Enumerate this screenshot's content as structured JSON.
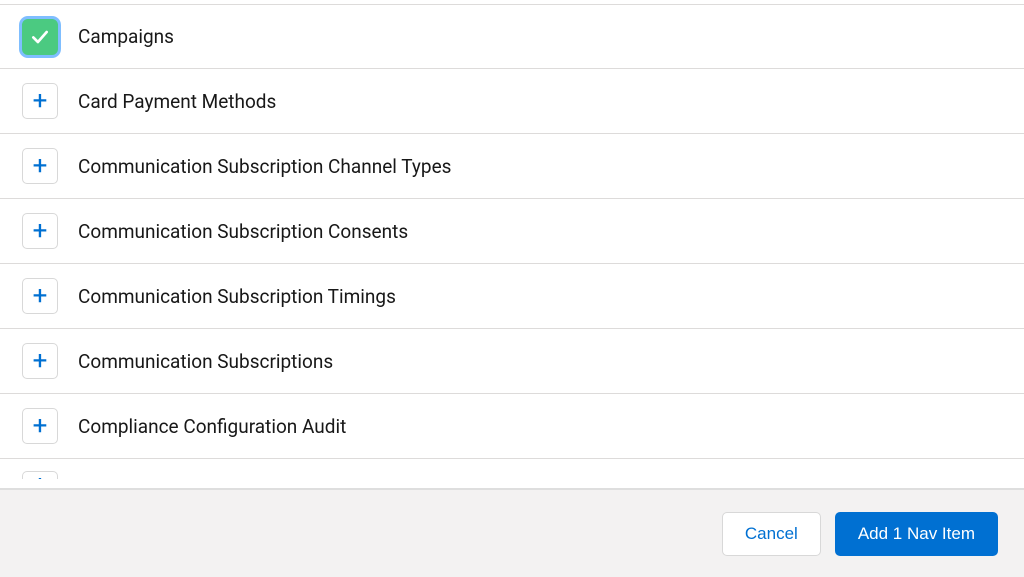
{
  "colors": {
    "brand": "#0070d2",
    "selected": "#4bca81",
    "border": "#dddbda",
    "footer_bg": "#f3f2f2"
  },
  "items": [
    {
      "label": "Campaigns",
      "selected": true,
      "icon": "check"
    },
    {
      "label": "Card Payment Methods",
      "selected": false,
      "icon": "plus"
    },
    {
      "label": "Communication Subscription Channel Types",
      "selected": false,
      "icon": "plus"
    },
    {
      "label": "Communication Subscription Consents",
      "selected": false,
      "icon": "plus"
    },
    {
      "label": "Communication Subscription Timings",
      "selected": false,
      "icon": "plus"
    },
    {
      "label": "Communication Subscriptions",
      "selected": false,
      "icon": "plus"
    },
    {
      "label": "Compliance Configuration Audit",
      "selected": false,
      "icon": "plus"
    }
  ],
  "partial_item": {
    "icon": "plus"
  },
  "footer": {
    "cancel_label": "Cancel",
    "add_label": "Add 1 Nav Item"
  }
}
